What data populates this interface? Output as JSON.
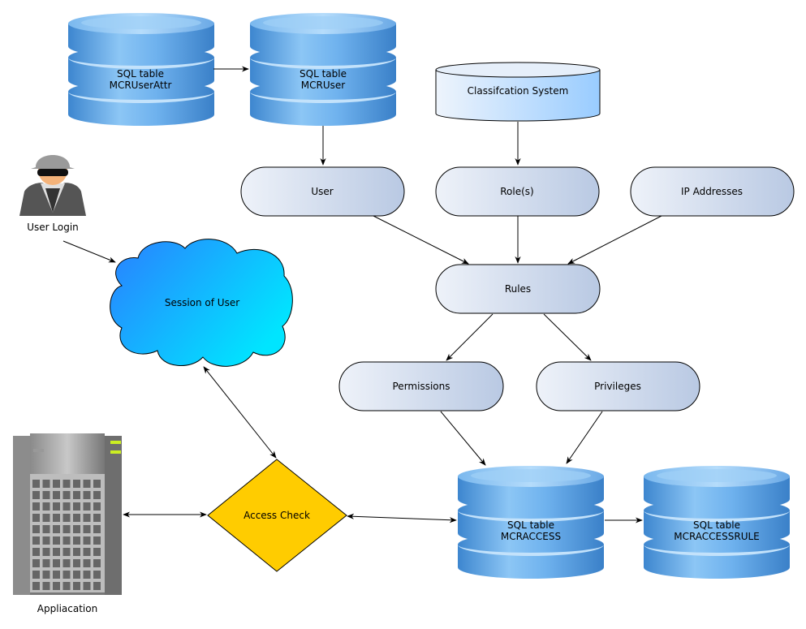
{
  "nodes": {
    "db_user_attr": {
      "line1": "SQL table",
      "line2": "MCRUserAttr"
    },
    "db_user": {
      "line1": "SQL table",
      "line2": "MCRUser"
    },
    "classification": {
      "label": "Classifcation System"
    },
    "user": {
      "label": "User"
    },
    "roles": {
      "label": "Role(s)"
    },
    "ip": {
      "label": "IP Addresses"
    },
    "rules": {
      "label": "Rules"
    },
    "permissions": {
      "label": "Permissions"
    },
    "privileges": {
      "label": "Privileges"
    },
    "db_access": {
      "line1": "SQL table",
      "line2": "MCRACCESS"
    },
    "db_access_rule": {
      "line1": "SQL table",
      "line2": "MCRACCESSRULE"
    },
    "access_check": {
      "label": "Access Check"
    },
    "session": {
      "label": "Session of User"
    },
    "user_login": {
      "label": "User Login"
    },
    "application": {
      "label": "Appliacation"
    }
  },
  "colors": {
    "db_blue": "#4a90d9",
    "pill_fill_start": "#eef2f9",
    "pill_fill_end": "#b9c9e3",
    "diamond": "#ffcc00",
    "cloud_start": "#2a7fff",
    "cloud_end": "#00e5ff"
  }
}
